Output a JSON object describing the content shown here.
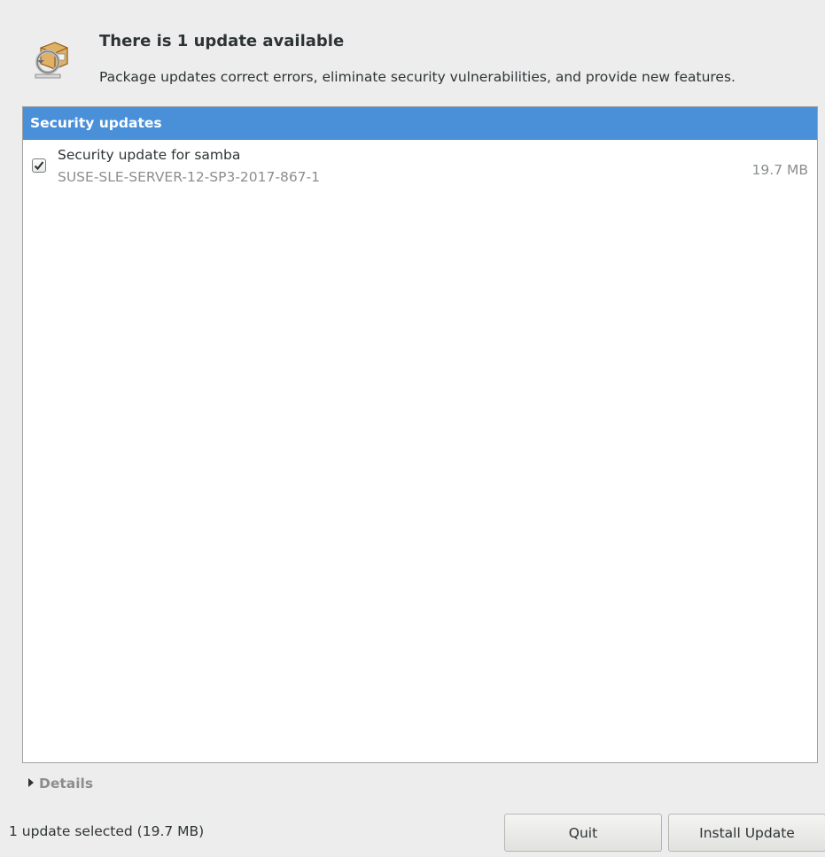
{
  "header": {
    "icon": "package-updater-icon",
    "title": "There is 1 update available",
    "subtitle": "Package updates correct errors, eliminate security vulnerabilities, and provide new features."
  },
  "update_list": {
    "section_title": "Security updates",
    "items": [
      {
        "checked": true,
        "name": "Security update for samba",
        "id": "SUSE-SLE-SERVER-12-SP3-2017-867-1",
        "size": "19.7 MB"
      }
    ]
  },
  "details": {
    "label": "Details",
    "expanded": false
  },
  "footer": {
    "status": "1 update selected (19.7 MB)",
    "quit_label": "Quit",
    "install_label": "Install Update"
  },
  "colors": {
    "section_header_bg": "#4a90d9",
    "window_bg": "#ededed"
  }
}
